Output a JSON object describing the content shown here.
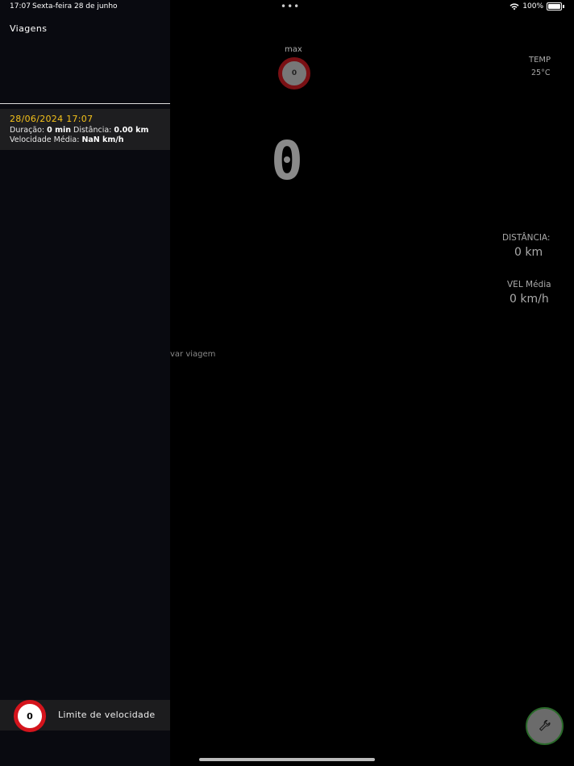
{
  "status_bar": {
    "time": "17:07",
    "date": "Sexta-feira 28 de junho",
    "dots": "•••",
    "battery": "100%"
  },
  "sidebar": {
    "title": "Viagens",
    "trips": [
      {
        "datetime": "28/06/2024 17:07",
        "duration_label": "Duração:",
        "duration_value": "0 min",
        "distance_label": "Distância:",
        "distance_value": "0.00 km",
        "avg_speed_label": "Velocidade Média:",
        "avg_speed_value": "NaN km/h"
      }
    ],
    "speed_limit": {
      "value": "0",
      "label": "Limite de velocidade"
    }
  },
  "dashboard": {
    "max_label": "max",
    "max_value": "0",
    "temp_label": "TEMP",
    "temp_value": "25°C",
    "speed": "0",
    "distance_label": "DISTÂNCIA:",
    "distance_value": "0 km",
    "avg_label": "VEL Média",
    "avg_value": "0 km/h",
    "partial_button": "var viagem"
  },
  "colors": {
    "accent_date": "#f5c21a",
    "limit_red": "#d4141c",
    "settings_ring": "#2a6a2a"
  },
  "icons": {
    "settings": "wrench-icon"
  }
}
